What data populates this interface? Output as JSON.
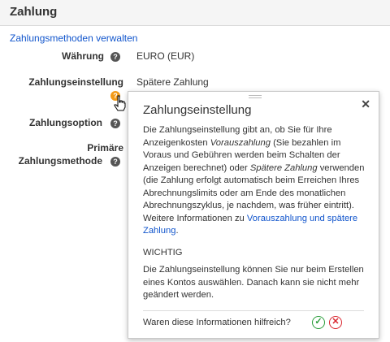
{
  "section": {
    "title": "Zahlung"
  },
  "manage_link": "Zahlungsmethoden verwalten",
  "rows": {
    "currency": {
      "label": "Währung",
      "value": "EURO (EUR)"
    },
    "payment_setting": {
      "label": "Zahlungseinstellung",
      "value": "Spätere Zahlung"
    },
    "payment_option": {
      "label": "Zahlungsoption"
    },
    "primary_method": {
      "label_line1": "Primäre",
      "label_line2": "Zahlungsmethode"
    }
  },
  "help_icon_glyph": "?",
  "popup": {
    "title": "Zahlungseinstellung",
    "close_glyph": "✕",
    "body_part1": "Die Zahlungseinstellung gibt an, ob Sie für Ihre Anzeigenkosten ",
    "body_em1": "Vorauszahlung",
    "body_part2": " (Sie bezahlen im Voraus und Gebühren werden beim Schalten der Anzeigen berechnet) oder ",
    "body_em2": "Spätere Zahlung",
    "body_part3": " verwenden (die Zahlung erfolgt automatisch beim Erreichen Ihres Abrechnungslimits oder am Ende des monatlichen Abrechnungszyklus, je nachdem, was früher eintritt). Weitere Informationen zu ",
    "body_link": "Vorauszahlung und spätere Zahlung",
    "body_end": ".",
    "important_heading": "WICHTIG",
    "important_body": "Die Zahlungseinstellung können Sie nur beim Erstellen eines Kontos auswählen. Danach kann sie nicht mehr geändert werden.",
    "feedback_question": "Waren diese Informationen hilfreich?",
    "feedback_yes": "✓",
    "feedback_no": "✕"
  },
  "colors": {
    "link": "#1155cc",
    "active_help": "#f39a18",
    "yes": "#2a9d3a",
    "no": "#d9252e"
  }
}
